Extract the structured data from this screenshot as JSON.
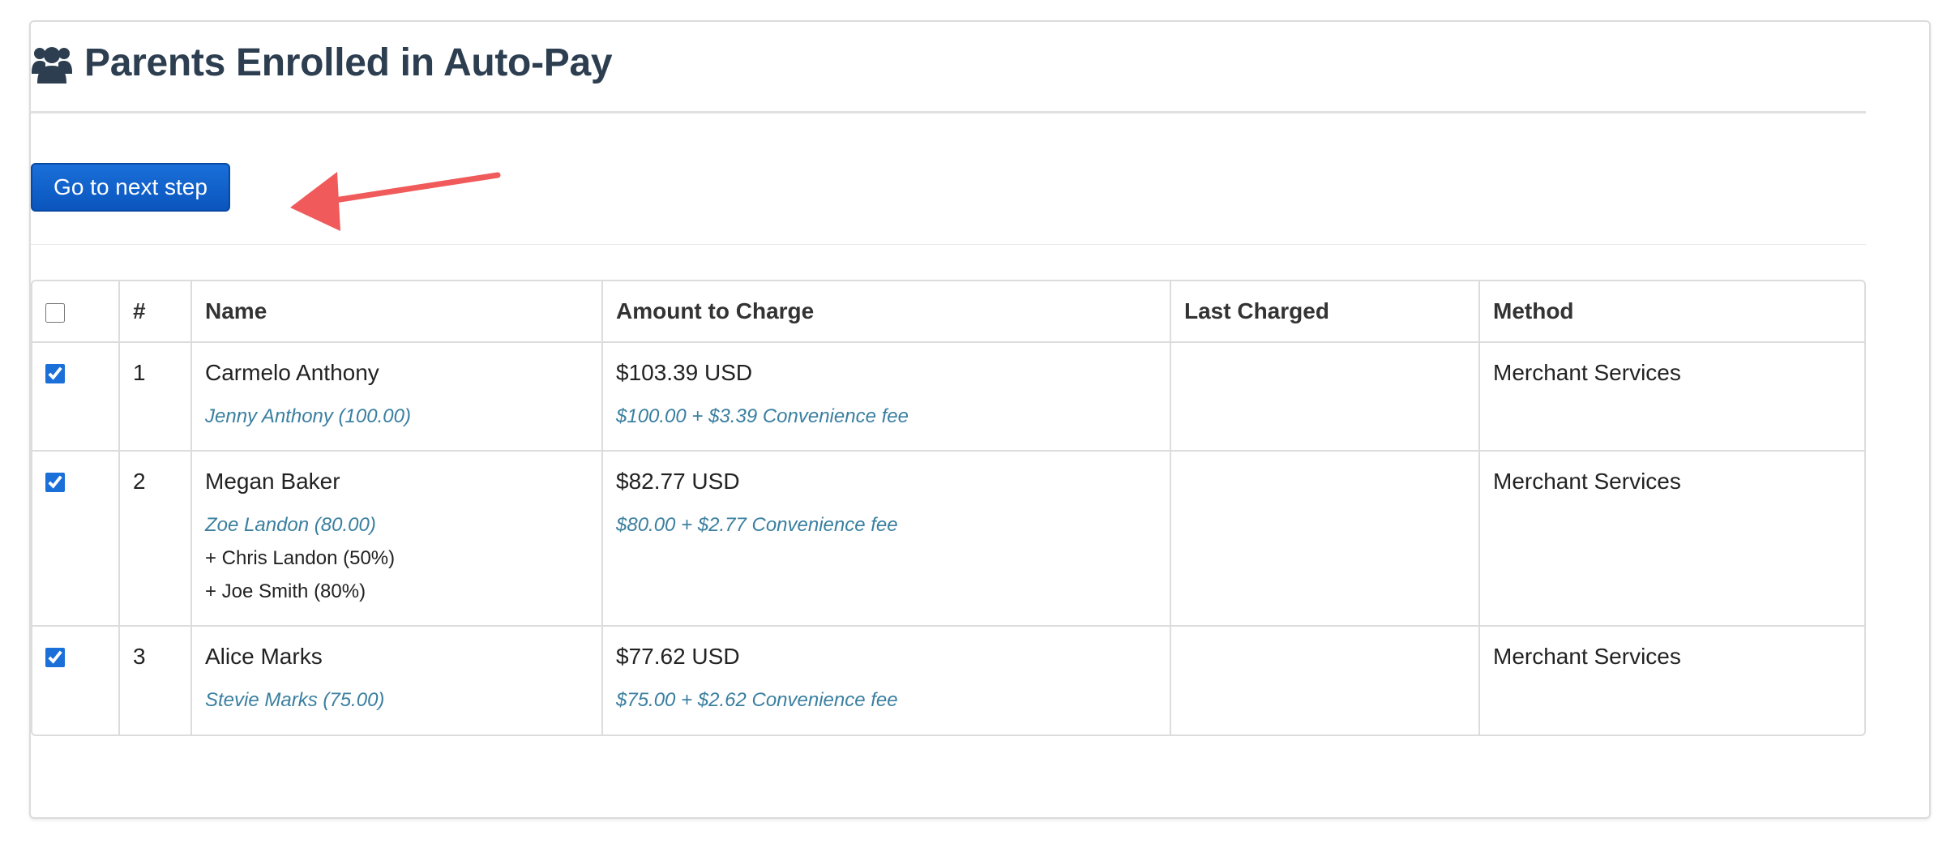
{
  "header": {
    "title": "Parents Enrolled in Auto-Pay",
    "icon": "users-icon"
  },
  "toolbar": {
    "next_label": "Go to next step"
  },
  "annotation": {
    "color": "#f05a5a",
    "icon": "arrow-left-annotation"
  },
  "table": {
    "columns": {
      "number": "#",
      "name": "Name",
      "amount": "Amount to Charge",
      "last_charged": "Last Charged",
      "method": "Method"
    },
    "rows": [
      {
        "checked": true,
        "number": "1",
        "name": "Carmelo Anthony",
        "students": [
          "Jenny Anthony (100.00)"
        ],
        "extras": [],
        "amount": "$103.39 USD",
        "breakdown": "$100.00 + $3.39 Convenience fee",
        "last_charged": "",
        "method": "Merchant Services"
      },
      {
        "checked": true,
        "number": "2",
        "name": "Megan Baker",
        "students": [
          "Zoe Landon (80.00)"
        ],
        "extras": [
          "+ Chris Landon (50%)",
          "+ Joe Smith (80%)"
        ],
        "amount": "$82.77 USD",
        "breakdown": "$80.00 + $2.77 Convenience fee",
        "last_charged": "",
        "method": "Merchant Services"
      },
      {
        "checked": true,
        "number": "3",
        "name": "Alice Marks",
        "students": [
          "Stevie Marks (75.00)"
        ],
        "extras": [],
        "amount": "$77.62 USD",
        "breakdown": "$75.00 + $2.62 Convenience fee",
        "last_charged": "",
        "method": "Merchant Services"
      }
    ]
  }
}
